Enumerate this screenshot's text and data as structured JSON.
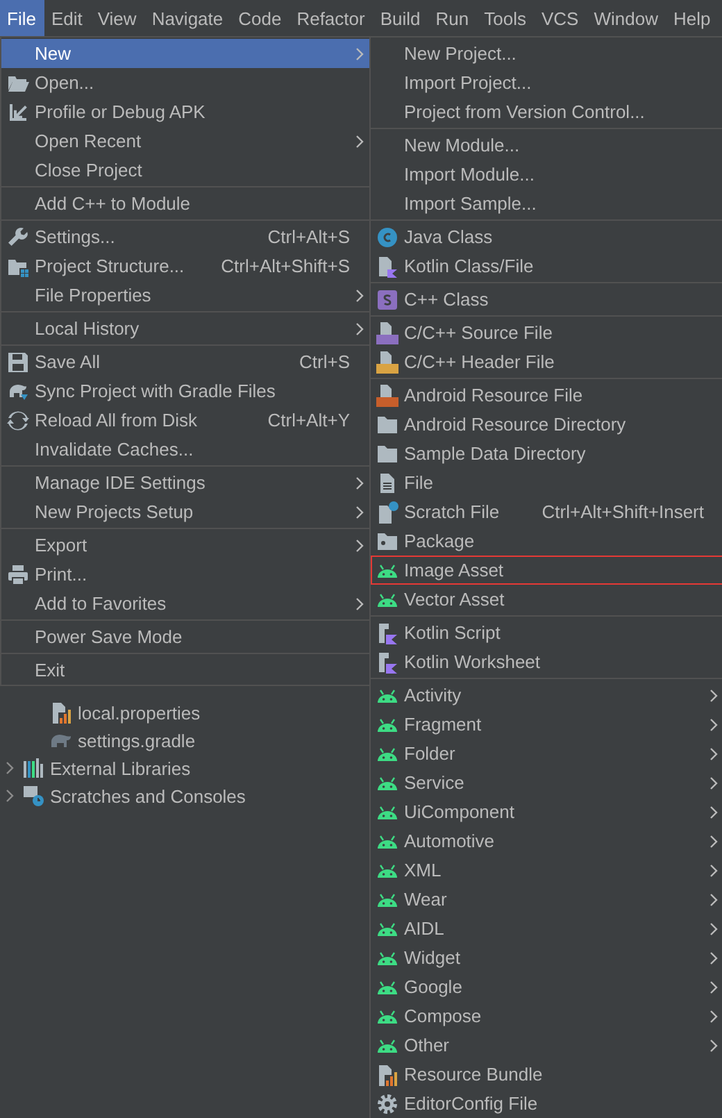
{
  "menu_bar": [
    {
      "label": "File",
      "selected": true
    },
    {
      "label": "Edit",
      "selected": false
    },
    {
      "label": "View",
      "selected": false
    },
    {
      "label": "Navigate",
      "selected": false
    },
    {
      "label": "Code",
      "selected": false
    },
    {
      "label": "Refactor",
      "selected": false
    },
    {
      "label": "Build",
      "selected": false
    },
    {
      "label": "Run",
      "selected": false
    },
    {
      "label": "Tools",
      "selected": false
    },
    {
      "label": "VCS",
      "selected": false
    },
    {
      "label": "Window",
      "selected": false
    },
    {
      "label": "Help",
      "selected": false
    }
  ],
  "project_tree": {
    "files": [
      {
        "label": "local.properties",
        "kind": "properties"
      },
      {
        "label": "settings.gradle",
        "kind": "gradle"
      }
    ],
    "roots": [
      {
        "label": "External Libraries",
        "kind": "libraries",
        "expanded": false
      },
      {
        "label": "Scratches and Consoles",
        "kind": "scratches",
        "expanded": false
      }
    ]
  },
  "file_menu": {
    "groups": [
      [
        {
          "label": "New",
          "kind": "plain",
          "submenu": true,
          "selected": true
        },
        {
          "label": "Open...",
          "kind": "folder-open",
          "selected": false
        },
        {
          "label": "Profile or Debug APK",
          "kind": "profile",
          "selected": false
        },
        {
          "label": "Open Recent",
          "kind": "plain",
          "submenu": true,
          "selected": false
        },
        {
          "label": "Close Project",
          "kind": "plain",
          "selected": false
        }
      ],
      [
        {
          "label": "Add C++ to Module",
          "kind": "plain",
          "selected": false
        }
      ],
      [
        {
          "label": "Settings...",
          "kind": "wrench",
          "shortcut": "Ctrl+Alt+S",
          "selected": false
        },
        {
          "label": "Project Structure...",
          "kind": "structure",
          "shortcut": "Ctrl+Alt+Shift+S",
          "selected": false
        },
        {
          "label": "File Properties",
          "kind": "plain",
          "submenu": true,
          "selected": false
        }
      ],
      [
        {
          "label": "Local History",
          "kind": "plain",
          "submenu": true,
          "selected": false
        }
      ],
      [
        {
          "label": "Save All",
          "kind": "save",
          "shortcut": "Ctrl+S",
          "selected": false
        },
        {
          "label": "Sync Project with Gradle Files",
          "kind": "gradle-sync",
          "selected": false
        },
        {
          "label": "Reload All from Disk",
          "kind": "reload",
          "shortcut": "Ctrl+Alt+Y",
          "selected": false
        },
        {
          "label": "Invalidate Caches...",
          "kind": "plain",
          "selected": false
        }
      ],
      [
        {
          "label": "Manage IDE Settings",
          "kind": "plain",
          "submenu": true,
          "selected": false
        },
        {
          "label": "New Projects Setup",
          "kind": "plain",
          "submenu": true,
          "selected": false
        }
      ],
      [
        {
          "label": "Export",
          "kind": "plain",
          "submenu": true,
          "selected": false
        },
        {
          "label": "Print...",
          "kind": "print",
          "selected": false
        },
        {
          "label": "Add to Favorites",
          "kind": "plain",
          "submenu": true,
          "selected": false
        }
      ],
      [
        {
          "label": "Power Save Mode",
          "kind": "plain",
          "selected": false
        }
      ],
      [
        {
          "label": "Exit",
          "kind": "plain",
          "selected": false
        }
      ]
    ]
  },
  "new_submenu": {
    "groups": [
      [
        {
          "label": "New Project...",
          "kind": "plain"
        },
        {
          "label": "Import Project...",
          "kind": "plain"
        },
        {
          "label": "Project from Version Control...",
          "kind": "plain"
        }
      ],
      [
        {
          "label": "New Module...",
          "kind": "plain"
        },
        {
          "label": "Import Module...",
          "kind": "plain"
        },
        {
          "label": "Import Sample...",
          "kind": "plain"
        }
      ],
      [
        {
          "label": "Java Class",
          "kind": "java-class"
        },
        {
          "label": "Kotlin Class/File",
          "kind": "kotlin-file"
        }
      ],
      [
        {
          "label": "C++ Class",
          "kind": "cpp-class"
        }
      ],
      [
        {
          "label": "C/C++ Source File",
          "kind": "cpp-source"
        },
        {
          "label": "C/C++ Header File",
          "kind": "cpp-header"
        }
      ],
      [
        {
          "label": "Android Resource File",
          "kind": "resource-file"
        },
        {
          "label": "Android Resource Directory",
          "kind": "folder"
        },
        {
          "label": "Sample Data Directory",
          "kind": "folder"
        },
        {
          "label": "File",
          "kind": "file"
        },
        {
          "label": "Scratch File",
          "kind": "scratch",
          "shortcut": "Ctrl+Alt+Shift+Insert"
        },
        {
          "label": "Package",
          "kind": "package"
        },
        {
          "label": "Image Asset",
          "kind": "android",
          "marked": true
        },
        {
          "label": "Vector Asset",
          "kind": "android"
        }
      ],
      [
        {
          "label": "Kotlin Script",
          "kind": "kotlin-script"
        },
        {
          "label": "Kotlin Worksheet",
          "kind": "kotlin-script"
        }
      ],
      [
        {
          "label": "Activity",
          "kind": "android",
          "submenu": true
        },
        {
          "label": "Fragment",
          "kind": "android",
          "submenu": true
        },
        {
          "label": "Folder",
          "kind": "android",
          "submenu": true
        },
        {
          "label": "Service",
          "kind": "android",
          "submenu": true
        },
        {
          "label": "UiComponent",
          "kind": "android",
          "submenu": true
        },
        {
          "label": "Automotive",
          "kind": "android",
          "submenu": true
        },
        {
          "label": "XML",
          "kind": "android",
          "submenu": true
        },
        {
          "label": "Wear",
          "kind": "android",
          "submenu": true
        },
        {
          "label": "AIDL",
          "kind": "android",
          "submenu": true
        },
        {
          "label": "Widget",
          "kind": "android",
          "submenu": true
        },
        {
          "label": "Google",
          "kind": "android",
          "submenu": true
        },
        {
          "label": "Compose",
          "kind": "android",
          "submenu": true
        },
        {
          "label": "Other",
          "kind": "android",
          "submenu": true
        },
        {
          "label": "Resource Bundle",
          "kind": "properties"
        },
        {
          "label": "EditorConfig File",
          "kind": "gear"
        }
      ]
    ]
  }
}
